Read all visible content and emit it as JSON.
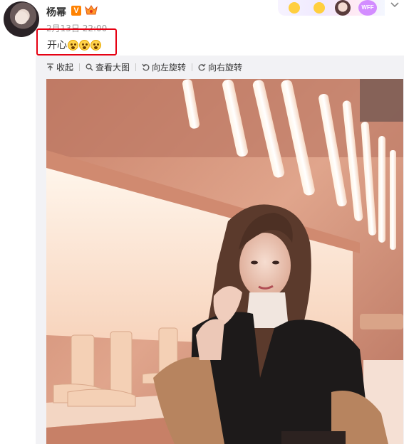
{
  "header": {
    "username": "杨幂",
    "verified_badge": "V",
    "post_time": "2月13日 22:00",
    "decor_badge_text": "WFF"
  },
  "post": {
    "text": "开心"
  },
  "toolbar": {
    "collapse_label": "收起",
    "view_large_label": "查看大图",
    "rotate_left_label": "向左旋转",
    "rotate_right_label": "向右旋转"
  },
  "colors": {
    "highlight_box": "#e60012",
    "verified": "#ff8200",
    "panel_bg": "#f2f2f5"
  },
  "icons": [
    "collapse-icon",
    "search-icon",
    "rotate-left-icon",
    "rotate-right-icon",
    "dropdown-arrow-icon"
  ]
}
